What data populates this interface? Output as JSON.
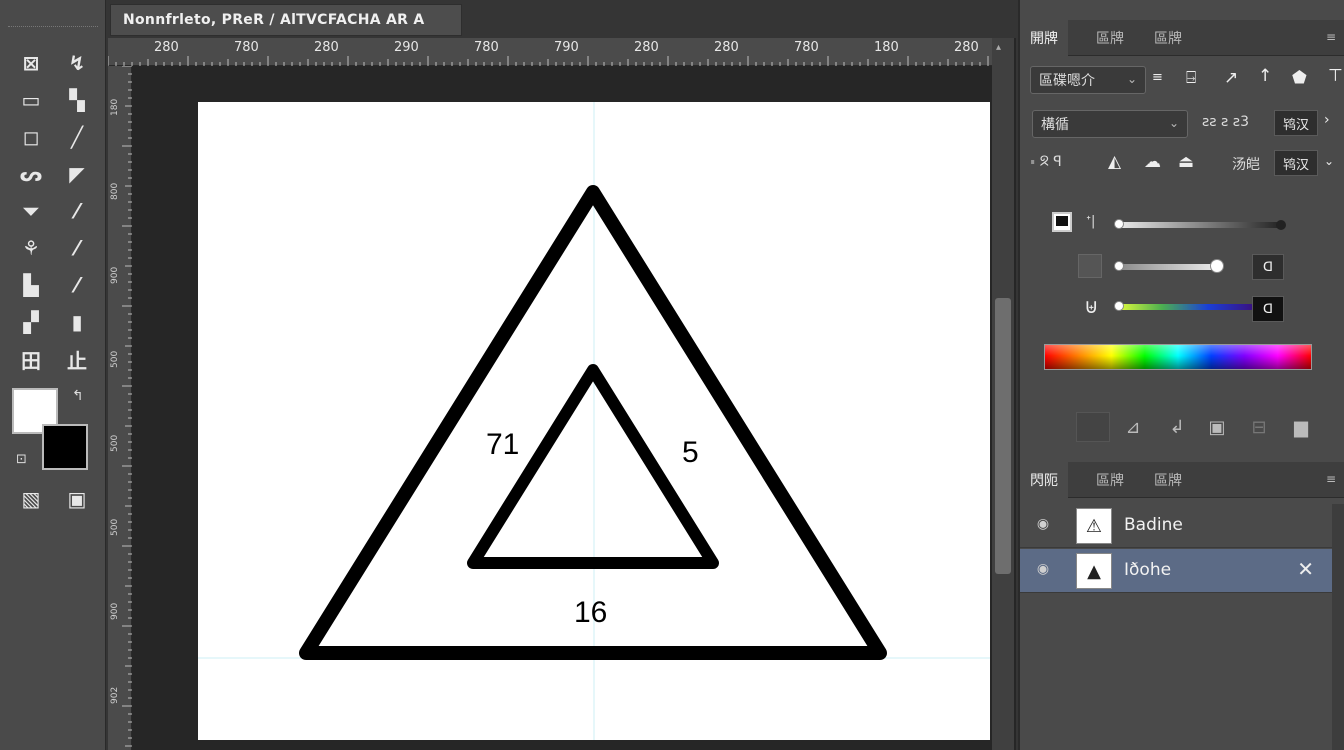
{
  "document": {
    "tab_title": "Nonnfrleto, PReR / AlTVCFACHA AR A"
  },
  "ruler": {
    "top_labels": [
      "280",
      "780",
      "280",
      "290",
      "780",
      "790",
      "280",
      "280",
      "780",
      "180",
      "280"
    ],
    "left_labels": [
      "180",
      "800",
      "900",
      "500",
      "500",
      "500",
      "900",
      "902"
    ]
  },
  "canvas": {
    "label_left": "71",
    "label_right": "5",
    "label_bottom": "16"
  },
  "toolbar": {
    "tools": [
      "⊠",
      "↯",
      "▭",
      "▚",
      "◻",
      "╱",
      "ᔕ",
      "◤",
      "⏷",
      "⁄",
      "⚘",
      "⁄",
      "▙",
      "⁄",
      "▞",
      "▮",
      "田",
      "止"
    ],
    "extra_icons": [
      "▧",
      "▣"
    ]
  },
  "colors": {
    "foreground": "#ffffff",
    "background": "#000000",
    "selection": "#5c6b86"
  },
  "properties_panel": {
    "tabs": [
      "開牌",
      "區牌",
      "區牌"
    ],
    "preset_dropdown": "區碟嗯介",
    "mode_dropdown": "構循",
    "size_label": "ƨƨ ƨ ƨ3",
    "size_value": "鸨汉",
    "row3_label_left": "꞊ ᘝ ꟼ",
    "row3_label_right": "汤皑",
    "row3_value": "鸨汉",
    "slider2_value": "ᗡ",
    "slider3_value": "ᗡ"
  },
  "layers_panel": {
    "tabs": [
      "閃阨",
      "區牌",
      "區牌"
    ],
    "layers": [
      {
        "name": "Badine",
        "thumb": "⚠",
        "selected": false
      },
      {
        "name": "Iðohe",
        "thumb": "▲",
        "selected": true
      }
    ]
  }
}
